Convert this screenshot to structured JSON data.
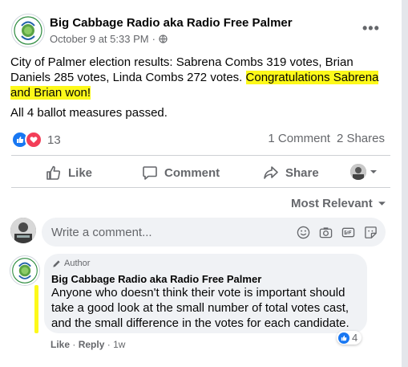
{
  "post": {
    "page_name": "Big Cabbage Radio aka Radio Free Palmer",
    "date": "October 9 at 5:33 PM",
    "separator": "·",
    "text_plain": "City of Palmer election results: Sabrena Combs 319 votes, Brian Daniels 285 votes, Linda Combs 272 votes. ",
    "text_highlight": "Congratulations Sabrena and Brian won!",
    "text_second": "All 4 ballot measures passed.",
    "reaction_count": "13",
    "comment_count": "1 Comment",
    "share_count": "2 Shares",
    "highlight_color": "#fdf91a"
  },
  "actions": {
    "like": "Like",
    "comment": "Comment",
    "share": "Share"
  },
  "sort_label": "Most Relevant",
  "composer": {
    "placeholder": "Write a comment..."
  },
  "comment": {
    "badge": "Author",
    "name": "Big Cabbage Radio aka Radio Free Palmer",
    "text": "Anyone who doesn't think their vote is important should take a good look at the small number of total votes cast, and the small difference in the votes for each candidate.",
    "reaction_count": "4",
    "like": "Like",
    "reply": "Reply",
    "dot": "·",
    "time": "1w"
  }
}
